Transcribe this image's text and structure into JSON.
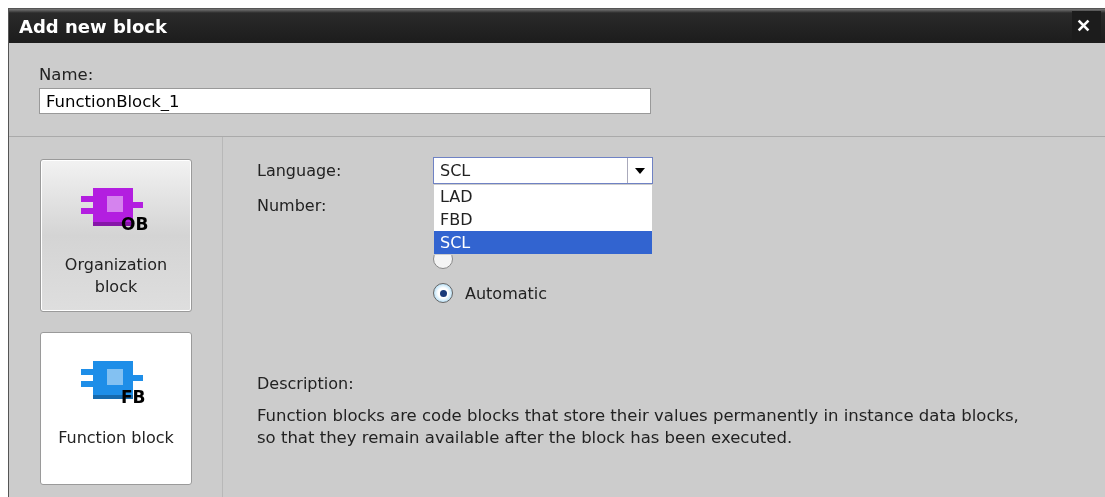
{
  "window": {
    "title": "Add new block",
    "close": "✕"
  },
  "name": {
    "label": "Name:",
    "value": "FunctionBlock_1"
  },
  "block_types": [
    {
      "label": "Organization block",
      "badge": "OB",
      "color": "#b31ee0",
      "selected": true
    },
    {
      "label": "Function block",
      "badge": "FB",
      "color": "#1e8ee8",
      "selected": false
    }
  ],
  "language": {
    "label": "Language:",
    "value": "SCL",
    "expanded": true,
    "options": [
      {
        "label": "LAD",
        "selected": false
      },
      {
        "label": "FBD",
        "selected": false
      },
      {
        "label": "SCL",
        "selected": true
      }
    ]
  },
  "number": {
    "label": "Number:",
    "modes": [
      {
        "selected": false
      },
      {
        "label": "Automatic",
        "selected": true
      }
    ]
  },
  "description": {
    "label": "Description:",
    "lines": [
      "Function blocks are code blocks that store their values permanently in instance data blocks,",
      "so that they remain available after the block has been executed."
    ]
  }
}
